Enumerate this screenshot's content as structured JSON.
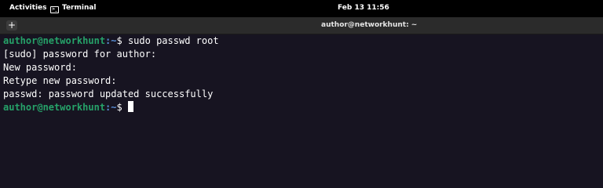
{
  "topbar": {
    "activities": "Activities",
    "app_name": "Terminal",
    "clock": "Feb 13  11:56"
  },
  "window": {
    "title": "author@networkhunt: ~",
    "new_tab_symbol": "+"
  },
  "terminal": {
    "prompt_user_host": "author@networkhunt",
    "prompt_path": ":~",
    "prompt_symbol": "$ ",
    "command": "sudo passwd root",
    "output": [
      "[sudo] password for author:",
      "New password:",
      "Retype new password:",
      "passwd: password updated successfully"
    ]
  },
  "colors": {
    "background": "#171421",
    "prompt_user": "#26a269",
    "prompt_path": "#5a8fd6"
  }
}
